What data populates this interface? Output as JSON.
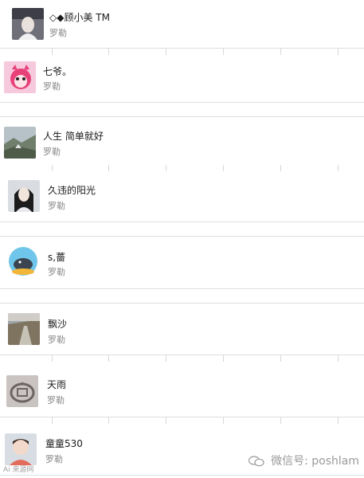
{
  "contacts": [
    {
      "name": "◇◆顾小美 TM",
      "subtitle": "罗勒"
    },
    {
      "name": "七爷。",
      "subtitle": "罗勒"
    },
    {
      "name": "人生 简单就好",
      "subtitle": "罗勒"
    },
    {
      "name": "久违的阳光",
      "subtitle": "罗勒"
    },
    {
      "name": "s,薔",
      "subtitle": "罗勒"
    },
    {
      "name": "飘沙",
      "subtitle": "罗勒"
    },
    {
      "name": "天雨",
      "subtitle": "罗勒"
    },
    {
      "name": "童童530",
      "subtitle": "罗勒"
    }
  ],
  "watermark": {
    "text": "微信号: poshlam"
  },
  "brand": {
    "text": "Ai 来源网"
  }
}
